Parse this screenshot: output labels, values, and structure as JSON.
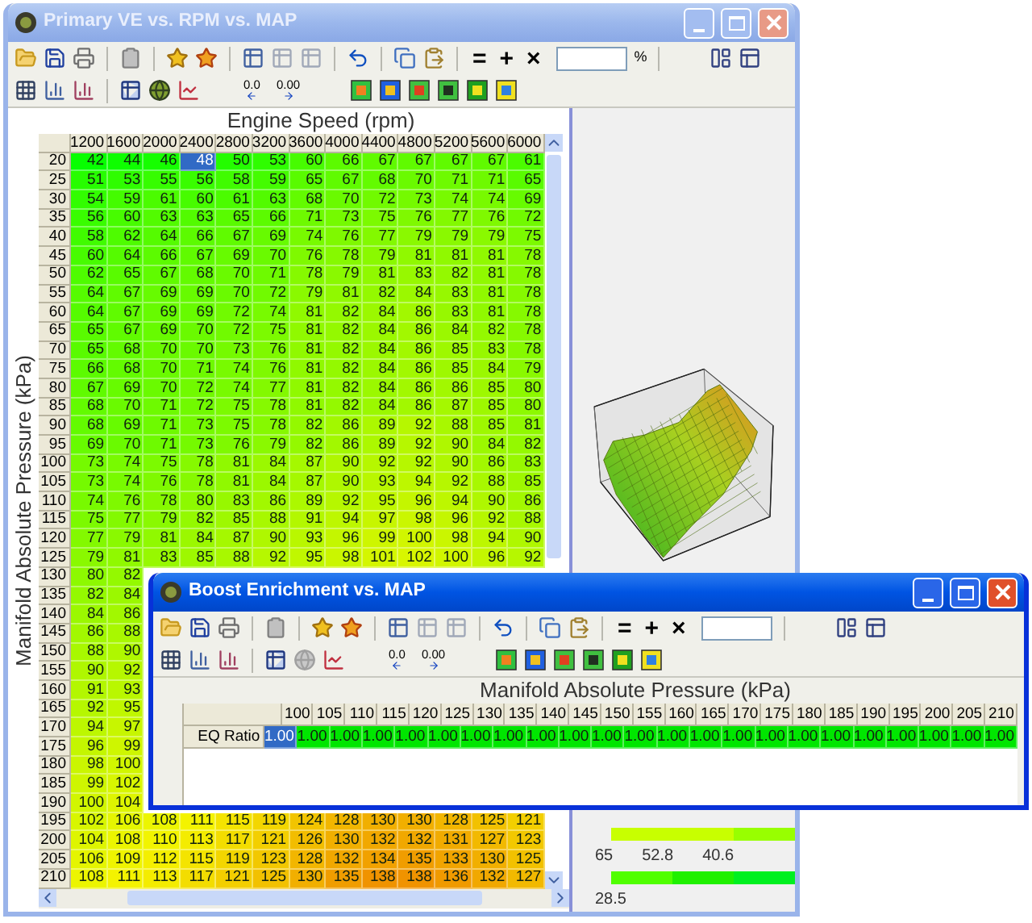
{
  "main_window": {
    "title": "Primary VE vs. RPM vs. MAP",
    "active": false,
    "toolbar": {
      "operators": [
        "=",
        "+",
        "×"
      ],
      "field_suffix": "%",
      "decimal_buttons": [
        {
          "label": "0.0",
          "kind": "decrease"
        },
        {
          "label": "0.00",
          "kind": "increase"
        }
      ]
    },
    "x_axis_title": "Engine Speed (rpm)",
    "y_axis_title": "Manifold Absolute Pressure (kPa)",
    "table": {
      "columns": [
        "1200",
        "1600",
        "2000",
        "2400",
        "2800",
        "3200",
        "3600",
        "4000",
        "4400",
        "4800",
        "5200",
        "5600",
        "6000"
      ],
      "rows": [
        {
          "label": "20",
          "cells": [
            {
              "value": "42",
              "selected": false
            },
            {
              "value": "44",
              "selected": false
            },
            {
              "value": "46",
              "selected": false
            },
            {
              "value": "48",
              "selected": true
            },
            {
              "value": "50",
              "selected": false
            },
            {
              "value": "53",
              "selected": false
            },
            {
              "value": "60",
              "selected": false
            },
            {
              "value": "66",
              "selected": false
            },
            {
              "value": "67",
              "selected": false
            },
            {
              "value": "67",
              "selected": false
            },
            {
              "value": "67",
              "selected": false
            },
            {
              "value": "67",
              "selected": false
            },
            {
              "value": "61",
              "selected": false
            }
          ]
        },
        {
          "label": "25",
          "cells": [
            {
              "value": "51",
              "selected": false
            },
            {
              "value": "53",
              "selected": false
            },
            {
              "value": "55",
              "selected": false
            },
            {
              "value": "56",
              "selected": false
            },
            {
              "value": "58",
              "selected": false
            },
            {
              "value": "59",
              "selected": false
            },
            {
              "value": "65",
              "selected": false
            },
            {
              "value": "67",
              "selected": false
            },
            {
              "value": "68",
              "selected": false
            },
            {
              "value": "70",
              "selected": false
            },
            {
              "value": "71",
              "selected": false
            },
            {
              "value": "71",
              "selected": false
            },
            {
              "value": "65",
              "selected": false
            }
          ]
        },
        {
          "label": "30",
          "cells": [
            {
              "value": "54",
              "selected": false
            },
            {
              "value": "59",
              "selected": false
            },
            {
              "value": "61",
              "selected": false
            },
            {
              "value": "60",
              "selected": false
            },
            {
              "value": "61",
              "selected": false
            },
            {
              "value": "63",
              "selected": false
            },
            {
              "value": "68",
              "selected": false
            },
            {
              "value": "70",
              "selected": false
            },
            {
              "value": "72",
              "selected": false
            },
            {
              "value": "73",
              "selected": false
            },
            {
              "value": "74",
              "selected": false
            },
            {
              "value": "74",
              "selected": false
            },
            {
              "value": "69",
              "selected": false
            }
          ]
        },
        {
          "label": "35",
          "cells": [
            {
              "value": "56",
              "selected": false
            },
            {
              "value": "60",
              "selected": false
            },
            {
              "value": "63",
              "selected": false
            },
            {
              "value": "63",
              "selected": false
            },
            {
              "value": "65",
              "selected": false
            },
            {
              "value": "66",
              "selected": false
            },
            {
              "value": "71",
              "selected": false
            },
            {
              "value": "73",
              "selected": false
            },
            {
              "value": "75",
              "selected": false
            },
            {
              "value": "76",
              "selected": false
            },
            {
              "value": "77",
              "selected": false
            },
            {
              "value": "76",
              "selected": false
            },
            {
              "value": "72",
              "selected": false
            }
          ]
        },
        {
          "label": "40",
          "cells": [
            {
              "value": "58",
              "selected": false
            },
            {
              "value": "62",
              "selected": false
            },
            {
              "value": "64",
              "selected": false
            },
            {
              "value": "66",
              "selected": false
            },
            {
              "value": "67",
              "selected": false
            },
            {
              "value": "69",
              "selected": false
            },
            {
              "value": "74",
              "selected": false
            },
            {
              "value": "76",
              "selected": false
            },
            {
              "value": "77",
              "selected": false
            },
            {
              "value": "79",
              "selected": false
            },
            {
              "value": "79",
              "selected": false
            },
            {
              "value": "79",
              "selected": false
            },
            {
              "value": "75",
              "selected": false
            }
          ]
        },
        {
          "label": "45",
          "cells": [
            {
              "value": "60",
              "selected": false
            },
            {
              "value": "64",
              "selected": false
            },
            {
              "value": "66",
              "selected": false
            },
            {
              "value": "67",
              "selected": false
            },
            {
              "value": "69",
              "selected": false
            },
            {
              "value": "70",
              "selected": false
            },
            {
              "value": "76",
              "selected": false
            },
            {
              "value": "78",
              "selected": false
            },
            {
              "value": "79",
              "selected": false
            },
            {
              "value": "81",
              "selected": false
            },
            {
              "value": "81",
              "selected": false
            },
            {
              "value": "81",
              "selected": false
            },
            {
              "value": "78",
              "selected": false
            }
          ]
        },
        {
          "label": "50",
          "cells": [
            {
              "value": "62",
              "selected": false
            },
            {
              "value": "65",
              "selected": false
            },
            {
              "value": "67",
              "selected": false
            },
            {
              "value": "68",
              "selected": false
            },
            {
              "value": "70",
              "selected": false
            },
            {
              "value": "71",
              "selected": false
            },
            {
              "value": "78",
              "selected": false
            },
            {
              "value": "79",
              "selected": false
            },
            {
              "value": "81",
              "selected": false
            },
            {
              "value": "83",
              "selected": false
            },
            {
              "value": "82",
              "selected": false
            },
            {
              "value": "81",
              "selected": false
            },
            {
              "value": "78",
              "selected": false
            }
          ]
        },
        {
          "label": "55",
          "cells": [
            {
              "value": "64",
              "selected": false
            },
            {
              "value": "67",
              "selected": false
            },
            {
              "value": "69",
              "selected": false
            },
            {
              "value": "69",
              "selected": false
            },
            {
              "value": "70",
              "selected": false
            },
            {
              "value": "72",
              "selected": false
            },
            {
              "value": "79",
              "selected": false
            },
            {
              "value": "81",
              "selected": false
            },
            {
              "value": "82",
              "selected": false
            },
            {
              "value": "84",
              "selected": false
            },
            {
              "value": "83",
              "selected": false
            },
            {
              "value": "81",
              "selected": false
            },
            {
              "value": "78",
              "selected": false
            }
          ]
        },
        {
          "label": "60",
          "cells": [
            {
              "value": "64",
              "selected": false
            },
            {
              "value": "67",
              "selected": false
            },
            {
              "value": "69",
              "selected": false
            },
            {
              "value": "69",
              "selected": false
            },
            {
              "value": "72",
              "selected": false
            },
            {
              "value": "74",
              "selected": false
            },
            {
              "value": "81",
              "selected": false
            },
            {
              "value": "82",
              "selected": false
            },
            {
              "value": "84",
              "selected": false
            },
            {
              "value": "86",
              "selected": false
            },
            {
              "value": "83",
              "selected": false
            },
            {
              "value": "81",
              "selected": false
            },
            {
              "value": "78",
              "selected": false
            }
          ]
        },
        {
          "label": "65",
          "cells": [
            {
              "value": "65",
              "selected": false
            },
            {
              "value": "67",
              "selected": false
            },
            {
              "value": "69",
              "selected": false
            },
            {
              "value": "70",
              "selected": false
            },
            {
              "value": "72",
              "selected": false
            },
            {
              "value": "75",
              "selected": false
            },
            {
              "value": "81",
              "selected": false
            },
            {
              "value": "82",
              "selected": false
            },
            {
              "value": "84",
              "selected": false
            },
            {
              "value": "86",
              "selected": false
            },
            {
              "value": "84",
              "selected": false
            },
            {
              "value": "82",
              "selected": false
            },
            {
              "value": "78",
              "selected": false
            }
          ]
        },
        {
          "label": "70",
          "cells": [
            {
              "value": "65",
              "selected": false
            },
            {
              "value": "68",
              "selected": false
            },
            {
              "value": "70",
              "selected": false
            },
            {
              "value": "70",
              "selected": false
            },
            {
              "value": "73",
              "selected": false
            },
            {
              "value": "76",
              "selected": false
            },
            {
              "value": "81",
              "selected": false
            },
            {
              "value": "82",
              "selected": false
            },
            {
              "value": "84",
              "selected": false
            },
            {
              "value": "86",
              "selected": false
            },
            {
              "value": "85",
              "selected": false
            },
            {
              "value": "83",
              "selected": false
            },
            {
              "value": "78",
              "selected": false
            }
          ]
        },
        {
          "label": "75",
          "cells": [
            {
              "value": "66",
              "selected": false
            },
            {
              "value": "68",
              "selected": false
            },
            {
              "value": "70",
              "selected": false
            },
            {
              "value": "71",
              "selected": false
            },
            {
              "value": "74",
              "selected": false
            },
            {
              "value": "76",
              "selected": false
            },
            {
              "value": "81",
              "selected": false
            },
            {
              "value": "82",
              "selected": false
            },
            {
              "value": "84",
              "selected": false
            },
            {
              "value": "86",
              "selected": false
            },
            {
              "value": "85",
              "selected": false
            },
            {
              "value": "84",
              "selected": false
            },
            {
              "value": "79",
              "selected": false
            }
          ]
        },
        {
          "label": "80",
          "cells": [
            {
              "value": "67",
              "selected": false
            },
            {
              "value": "69",
              "selected": false
            },
            {
              "value": "70",
              "selected": false
            },
            {
              "value": "72",
              "selected": false
            },
            {
              "value": "74",
              "selected": false
            },
            {
              "value": "77",
              "selected": false
            },
            {
              "value": "81",
              "selected": false
            },
            {
              "value": "82",
              "selected": false
            },
            {
              "value": "84",
              "selected": false
            },
            {
              "value": "86",
              "selected": false
            },
            {
              "value": "86",
              "selected": false
            },
            {
              "value": "85",
              "selected": false
            },
            {
              "value": "80",
              "selected": false
            }
          ]
        },
        {
          "label": "85",
          "cells": [
            {
              "value": "68",
              "selected": false
            },
            {
              "value": "70",
              "selected": false
            },
            {
              "value": "71",
              "selected": false
            },
            {
              "value": "72",
              "selected": false
            },
            {
              "value": "75",
              "selected": false
            },
            {
              "value": "78",
              "selected": false
            },
            {
              "value": "81",
              "selected": false
            },
            {
              "value": "82",
              "selected": false
            },
            {
              "value": "84",
              "selected": false
            },
            {
              "value": "86",
              "selected": false
            },
            {
              "value": "87",
              "selected": false
            },
            {
              "value": "85",
              "selected": false
            },
            {
              "value": "80",
              "selected": false
            }
          ]
        },
        {
          "label": "90",
          "cells": [
            {
              "value": "68",
              "selected": false
            },
            {
              "value": "69",
              "selected": false
            },
            {
              "value": "71",
              "selected": false
            },
            {
              "value": "73",
              "selected": false
            },
            {
              "value": "75",
              "selected": false
            },
            {
              "value": "78",
              "selected": false
            },
            {
              "value": "82",
              "selected": false
            },
            {
              "value": "86",
              "selected": false
            },
            {
              "value": "89",
              "selected": false
            },
            {
              "value": "92",
              "selected": false
            },
            {
              "value": "88",
              "selected": false
            },
            {
              "value": "85",
              "selected": false
            },
            {
              "value": "81",
              "selected": false
            }
          ]
        },
        {
          "label": "95",
          "cells": [
            {
              "value": "69",
              "selected": false
            },
            {
              "value": "70",
              "selected": false
            },
            {
              "value": "71",
              "selected": false
            },
            {
              "value": "73",
              "selected": false
            },
            {
              "value": "76",
              "selected": false
            },
            {
              "value": "79",
              "selected": false
            },
            {
              "value": "82",
              "selected": false
            },
            {
              "value": "86",
              "selected": false
            },
            {
              "value": "89",
              "selected": false
            },
            {
              "value": "92",
              "selected": false
            },
            {
              "value": "90",
              "selected": false
            },
            {
              "value": "84",
              "selected": false
            },
            {
              "value": "82",
              "selected": false
            }
          ]
        },
        {
          "label": "100",
          "cells": [
            {
              "value": "73",
              "selected": false
            },
            {
              "value": "74",
              "selected": false
            },
            {
              "value": "75",
              "selected": false
            },
            {
              "value": "78",
              "selected": false
            },
            {
              "value": "81",
              "selected": false
            },
            {
              "value": "84",
              "selected": false
            },
            {
              "value": "87",
              "selected": false
            },
            {
              "value": "90",
              "selected": false
            },
            {
              "value": "92",
              "selected": false
            },
            {
              "value": "92",
              "selected": false
            },
            {
              "value": "90",
              "selected": false
            },
            {
              "value": "86",
              "selected": false
            },
            {
              "value": "83",
              "selected": false
            }
          ]
        },
        {
          "label": "105",
          "cells": [
            {
              "value": "73",
              "selected": false
            },
            {
              "value": "74",
              "selected": false
            },
            {
              "value": "76",
              "selected": false
            },
            {
              "value": "78",
              "selected": false
            },
            {
              "value": "81",
              "selected": false
            },
            {
              "value": "84",
              "selected": false
            },
            {
              "value": "87",
              "selected": false
            },
            {
              "value": "90",
              "selected": false
            },
            {
              "value": "93",
              "selected": false
            },
            {
              "value": "94",
              "selected": false
            },
            {
              "value": "92",
              "selected": false
            },
            {
              "value": "88",
              "selected": false
            },
            {
              "value": "85",
              "selected": false
            }
          ]
        },
        {
          "label": "110",
          "cells": [
            {
              "value": "74",
              "selected": false
            },
            {
              "value": "76",
              "selected": false
            },
            {
              "value": "78",
              "selected": false
            },
            {
              "value": "80",
              "selected": false
            },
            {
              "value": "83",
              "selected": false
            },
            {
              "value": "86",
              "selected": false
            },
            {
              "value": "89",
              "selected": false
            },
            {
              "value": "92",
              "selected": false
            },
            {
              "value": "95",
              "selected": false
            },
            {
              "value": "96",
              "selected": false
            },
            {
              "value": "94",
              "selected": false
            },
            {
              "value": "90",
              "selected": false
            },
            {
              "value": "86",
              "selected": false
            }
          ]
        },
        {
          "label": "115",
          "cells": [
            {
              "value": "75",
              "selected": false
            },
            {
              "value": "77",
              "selected": false
            },
            {
              "value": "79",
              "selected": false
            },
            {
              "value": "82",
              "selected": false
            },
            {
              "value": "85",
              "selected": false
            },
            {
              "value": "88",
              "selected": false
            },
            {
              "value": "91",
              "selected": false
            },
            {
              "value": "94",
              "selected": false
            },
            {
              "value": "97",
              "selected": false
            },
            {
              "value": "98",
              "selected": false
            },
            {
              "value": "96",
              "selected": false
            },
            {
              "value": "92",
              "selected": false
            },
            {
              "value": "88",
              "selected": false
            }
          ]
        },
        {
          "label": "120",
          "cells": [
            {
              "value": "77",
              "selected": false
            },
            {
              "value": "79",
              "selected": false
            },
            {
              "value": "81",
              "selected": false
            },
            {
              "value": "84",
              "selected": false
            },
            {
              "value": "87",
              "selected": false
            },
            {
              "value": "90",
              "selected": false
            },
            {
              "value": "93",
              "selected": false
            },
            {
              "value": "96",
              "selected": false
            },
            {
              "value": "99",
              "selected": false
            },
            {
              "value": "100",
              "selected": false
            },
            {
              "value": "98",
              "selected": false
            },
            {
              "value": "94",
              "selected": false
            },
            {
              "value": "90",
              "selected": false
            }
          ]
        },
        {
          "label": "125",
          "cells": [
            {
              "value": "79",
              "selected": false
            },
            {
              "value": "81",
              "selected": false
            },
            {
              "value": "83",
              "selected": false
            },
            {
              "value": "85",
              "selected": false
            },
            {
              "value": "88",
              "selected": false
            },
            {
              "value": "92",
              "selected": false
            },
            {
              "value": "95",
              "selected": false
            },
            {
              "value": "98",
              "selected": false
            },
            {
              "value": "101",
              "selected": false
            },
            {
              "value": "102",
              "selected": false
            },
            {
              "value": "100",
              "selected": false
            },
            {
              "value": "96",
              "selected": false
            },
            {
              "value": "92",
              "selected": false
            }
          ]
        },
        {
          "label": "130",
          "cells": [
            {
              "value": "80",
              "selected": false
            },
            {
              "value": "82",
              "selected": false
            }
          ]
        },
        {
          "label": "135",
          "cells": [
            {
              "value": "82",
              "selected": false
            },
            {
              "value": "84",
              "selected": false
            }
          ]
        },
        {
          "label": "140",
          "cells": [
            {
              "value": "84",
              "selected": false
            },
            {
              "value": "86",
              "selected": false
            }
          ]
        },
        {
          "label": "145",
          "cells": [
            {
              "value": "86",
              "selected": false
            },
            {
              "value": "88",
              "selected": false
            }
          ]
        },
        {
          "label": "150",
          "cells": [
            {
              "value": "88",
              "selected": false
            },
            {
              "value": "90",
              "selected": false
            }
          ]
        },
        {
          "label": "155",
          "cells": [
            {
              "value": "90",
              "selected": false
            },
            {
              "value": "92",
              "selected": false
            }
          ]
        },
        {
          "label": "160",
          "cells": [
            {
              "value": "91",
              "selected": false
            },
            {
              "value": "93",
              "selected": false
            }
          ]
        },
        {
          "label": "165",
          "cells": [
            {
              "value": "92",
              "selected": false
            },
            {
              "value": "95",
              "selected": false
            }
          ]
        },
        {
          "label": "170",
          "cells": [
            {
              "value": "94",
              "selected": false
            },
            {
              "value": "97",
              "selected": false
            }
          ]
        },
        {
          "label": "175",
          "cells": [
            {
              "value": "96",
              "selected": false
            },
            {
              "value": "99",
              "selected": false
            }
          ]
        },
        {
          "label": "180",
          "cells": [
            {
              "value": "98",
              "selected": false
            },
            {
              "value": "100",
              "selected": false
            }
          ]
        },
        {
          "label": "185",
          "cells": [
            {
              "value": "99",
              "selected": false
            },
            {
              "value": "102",
              "selected": false
            }
          ]
        },
        {
          "label": "190",
          "cells": [
            {
              "value": "100",
              "selected": false
            },
            {
              "value": "104",
              "selected": false
            }
          ]
        },
        {
          "label": "195",
          "cells": [
            {
              "value": "102",
              "selected": false
            },
            {
              "value": "106",
              "selected": false
            },
            {
              "value": "108",
              "selected": false
            },
            {
              "value": "111",
              "selected": false
            },
            {
              "value": "115",
              "selected": false
            },
            {
              "value": "119",
              "selected": false
            },
            {
              "value": "124",
              "selected": false
            },
            {
              "value": "128",
              "selected": false
            },
            {
              "value": "130",
              "selected": false
            },
            {
              "value": "130",
              "selected": false
            },
            {
              "value": "128",
              "selected": false
            },
            {
              "value": "125",
              "selected": false
            },
            {
              "value": "121",
              "selected": false
            }
          ]
        },
        {
          "label": "200",
          "cells": [
            {
              "value": "104",
              "selected": false
            },
            {
              "value": "108",
              "selected": false
            },
            {
              "value": "110",
              "selected": false
            },
            {
              "value": "113",
              "selected": false
            },
            {
              "value": "117",
              "selected": false
            },
            {
              "value": "121",
              "selected": false
            },
            {
              "value": "126",
              "selected": false
            },
            {
              "value": "130",
              "selected": false
            },
            {
              "value": "132",
              "selected": false
            },
            {
              "value": "132",
              "selected": false
            },
            {
              "value": "131",
              "selected": false
            },
            {
              "value": "127",
              "selected": false
            },
            {
              "value": "123",
              "selected": false
            }
          ]
        },
        {
          "label": "205",
          "cells": [
            {
              "value": "106",
              "selected": false
            },
            {
              "value": "109",
              "selected": false
            },
            {
              "value": "112",
              "selected": false
            },
            {
              "value": "115",
              "selected": false
            },
            {
              "value": "119",
              "selected": false
            },
            {
              "value": "123",
              "selected": false
            },
            {
              "value": "128",
              "selected": false
            },
            {
              "value": "132",
              "selected": false
            },
            {
              "value": "134",
              "selected": false
            },
            {
              "value": "135",
              "selected": false
            },
            {
              "value": "133",
              "selected": false
            },
            {
              "value": "130",
              "selected": false
            },
            {
              "value": "125",
              "selected": false
            }
          ]
        },
        {
          "label": "210",
          "cells": [
            {
              "value": "108",
              "selected": false
            },
            {
              "value": "111",
              "selected": false
            },
            {
              "value": "113",
              "selected": false
            },
            {
              "value": "117",
              "selected": false
            },
            {
              "value": "121",
              "selected": false
            },
            {
              "value": "125",
              "selected": false
            },
            {
              "value": "130",
              "selected": false
            },
            {
              "value": "135",
              "selected": false
            },
            {
              "value": "138",
              "selected": false
            },
            {
              "value": "138",
              "selected": false
            },
            {
              "value": "136",
              "selected": false
            },
            {
              "value": "132",
              "selected": false
            },
            {
              "value": "127",
              "selected": false
            }
          ]
        }
      ]
    },
    "scale_labels": [
      "65",
      "52.8",
      "40.6",
      "28.5"
    ]
  },
  "boost_window": {
    "title": "Boost Enrichment vs. MAP",
    "active": true,
    "toolbar": {
      "operators": [
        "=",
        "+",
        "×"
      ],
      "decimal_buttons": [
        {
          "label": "0.0",
          "kind": "decrease"
        },
        {
          "label": "0.00",
          "kind": "increase"
        }
      ]
    },
    "x_axis_title": "Manifold Absolute Pressure (kPa)",
    "table": {
      "columns": [
        "100",
        "105",
        "110",
        "115",
        "120",
        "125",
        "130",
        "135",
        "140",
        "145",
        "150",
        "155",
        "160",
        "165",
        "170",
        "175",
        "180",
        "185",
        "190",
        "195",
        "200",
        "205",
        "210"
      ],
      "rows": [
        {
          "label": "EQ Ratio",
          "cells": [
            {
              "value": "1.00",
              "selected": true
            },
            {
              "value": "1.00",
              "selected": false
            },
            {
              "value": "1.00",
              "selected": false
            },
            {
              "value": "1.00",
              "selected": false
            },
            {
              "value": "1.00",
              "selected": false
            },
            {
              "value": "1.00",
              "selected": false
            },
            {
              "value": "1.00",
              "selected": false
            },
            {
              "value": "1.00",
              "selected": false
            },
            {
              "value": "1.00",
              "selected": false
            },
            {
              "value": "1.00",
              "selected": false
            },
            {
              "value": "1.00",
              "selected": false
            },
            {
              "value": "1.00",
              "selected": false
            },
            {
              "value": "1.00",
              "selected": false
            },
            {
              "value": "1.00",
              "selected": false
            },
            {
              "value": "1.00",
              "selected": false
            },
            {
              "value": "1.00",
              "selected": false
            },
            {
              "value": "1.00",
              "selected": false
            },
            {
              "value": "1.00",
              "selected": false
            },
            {
              "value": "1.00",
              "selected": false
            },
            {
              "value": "1.00",
              "selected": false
            },
            {
              "value": "1.00",
              "selected": false
            },
            {
              "value": "1.00",
              "selected": false
            },
            {
              "value": "1.00",
              "selected": false
            }
          ]
        }
      ]
    }
  }
}
